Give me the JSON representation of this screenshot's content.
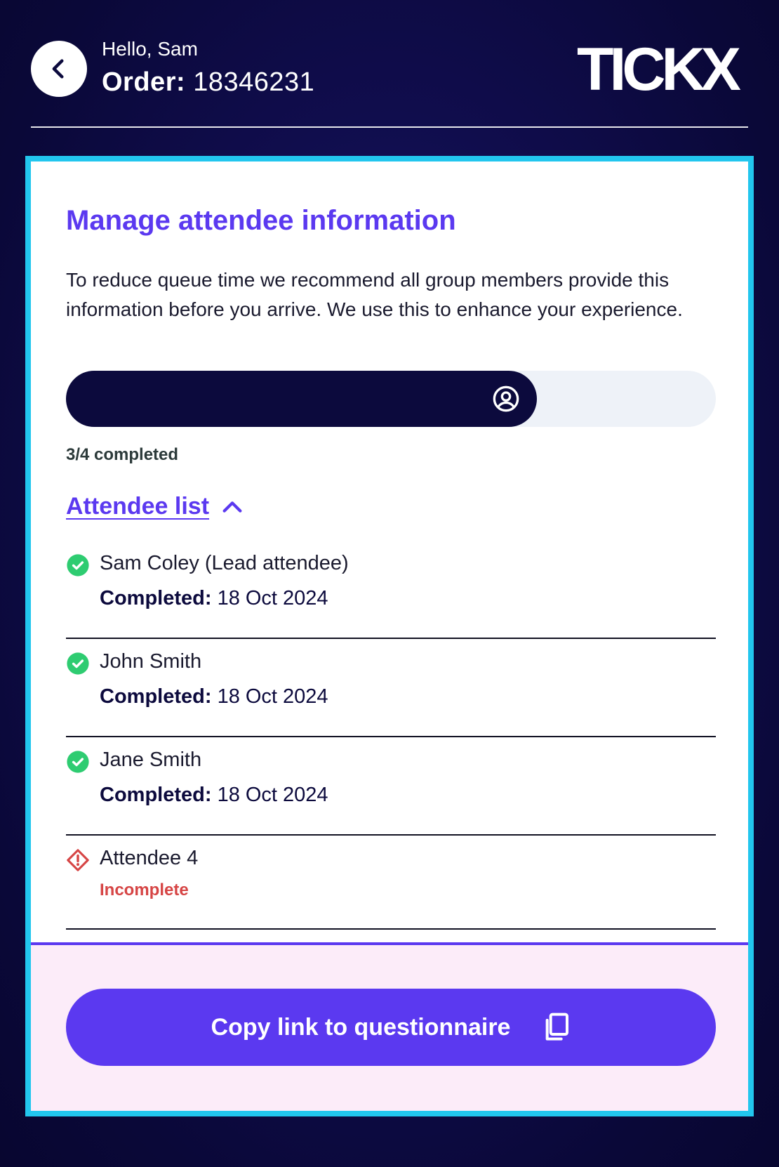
{
  "header": {
    "greeting": "Hello, Sam",
    "order_label": "Order:",
    "order_number": "18346231",
    "brand": "TICKX"
  },
  "main": {
    "title": "Manage attendee information",
    "description": "To reduce queue time we recommend all group members provide this information before you arrive. We use this to enhance your experience.",
    "progress": {
      "completed": 3,
      "total": 4,
      "fraction": 0.75,
      "label": "3/4 completed"
    },
    "attendee_list_label": "Attendee list",
    "attendees": [
      {
        "name": "Sam Coley (Lead attendee)",
        "status": "complete",
        "meta_label": "Completed:",
        "meta_value": "18 Oct 2024"
      },
      {
        "name": "John Smith",
        "status": "complete",
        "meta_label": "Completed:",
        "meta_value": "18 Oct 2024"
      },
      {
        "name": "Jane Smith",
        "status": "complete",
        "meta_label": "Completed:",
        "meta_value": "18 Oct 2024"
      },
      {
        "name": "Attendee 4",
        "status": "incomplete",
        "status_label": "Incomplete"
      }
    ]
  },
  "footer": {
    "copy_button_label": "Copy link to questionnaire"
  },
  "colors": {
    "accent": "#5b39f0",
    "border": "#22c6ee",
    "success": "#2ecc71",
    "error": "#d64545",
    "navy": "#0c0a3d"
  },
  "icons": {
    "back": "chevron-left-icon",
    "progress": "user-circle-icon",
    "toggle": "chevron-up-icon",
    "complete": "check-circle-icon",
    "incomplete": "warning-diamond-icon",
    "copy": "copy-icon"
  }
}
